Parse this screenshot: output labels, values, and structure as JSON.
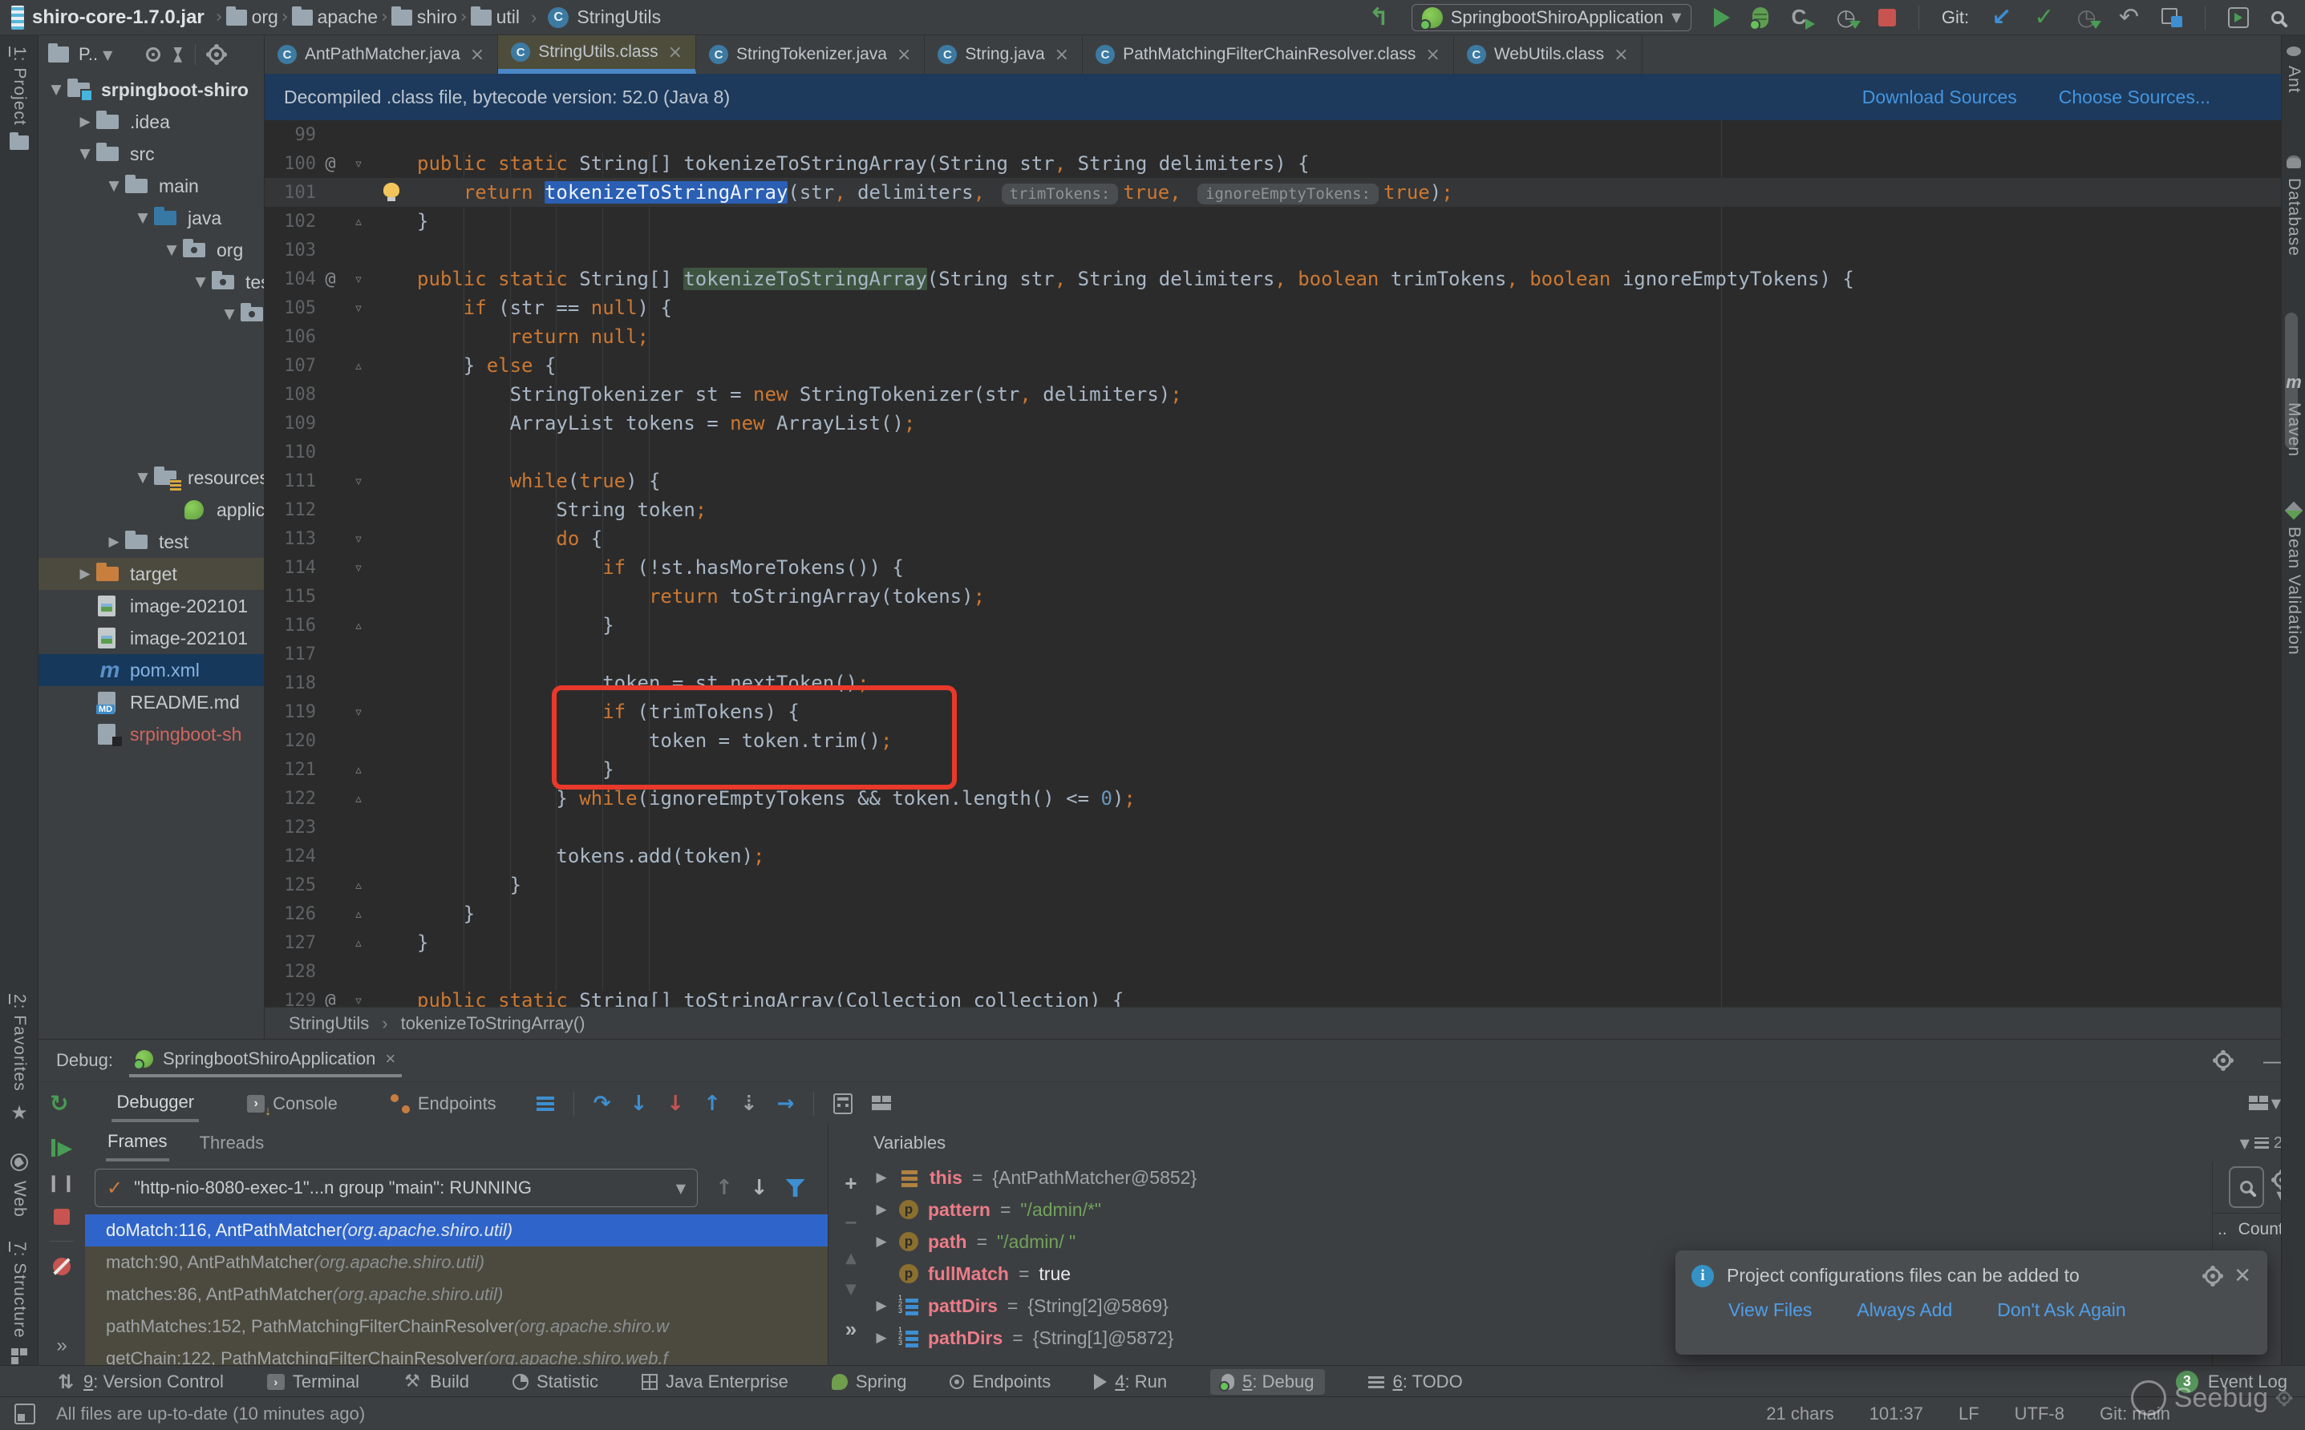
{
  "titlebar": {
    "jar": "shiro-core-1.7.0.jar",
    "path": [
      "org",
      "apache",
      "shiro",
      "util"
    ],
    "class_name": "StringUtils",
    "run_config": "SpringbootShiroApplication",
    "git_label": "Git:"
  },
  "left_stripe": {
    "top": [
      "1: Project"
    ],
    "bottom": [
      "2: Favorites",
      "Web",
      "7: Structure"
    ]
  },
  "right_stripe": [
    "Ant",
    "Database",
    "Maven",
    "Bean Validation"
  ],
  "project": {
    "header_label": "P..",
    "tree": [
      {
        "level": 0,
        "arrow": "open",
        "icon": "root",
        "label": "srpingboot-shiro",
        "cls": "t-root"
      },
      {
        "level": 1,
        "arrow": "closed",
        "icon": "folder",
        "label": ".idea"
      },
      {
        "level": 1,
        "arrow": "open",
        "icon": "folder",
        "label": "src"
      },
      {
        "level": 2,
        "arrow": "open",
        "icon": "folder",
        "label": "main"
      },
      {
        "level": 3,
        "arrow": "open",
        "icon": "java",
        "label": "java"
      },
      {
        "level": 4,
        "arrow": "open",
        "icon": "pkg",
        "label": "org"
      },
      {
        "level": 5,
        "arrow": "open",
        "icon": "pkg",
        "label": "test"
      },
      {
        "level": 6,
        "arrow": "open",
        "icon": "pkg",
        "label": ""
      },
      {
        "spacer": 164
      },
      {
        "level": 3,
        "arrow": "open",
        "icon": "res",
        "label": "resources"
      },
      {
        "level": 4,
        "arrow": "none",
        "icon": "spring",
        "label": "application"
      },
      {
        "level": 2,
        "arrow": "closed",
        "icon": "folder",
        "label": "test"
      },
      {
        "level": 1,
        "arrow": "closed",
        "icon": "target",
        "label": "target",
        "row": "r-olive"
      },
      {
        "level": 1,
        "arrow": "none",
        "icon": "img",
        "label": "image-202101"
      },
      {
        "level": 1,
        "arrow": "none",
        "icon": "img",
        "label": "image-202101"
      },
      {
        "level": 1,
        "arrow": "none",
        "icon": "maven",
        "label": "pom.xml",
        "row": "r-sel",
        "cls": "t-blue"
      },
      {
        "level": 1,
        "arrow": "none",
        "icon": "md",
        "label": "README.md"
      },
      {
        "level": 1,
        "arrow": "none",
        "icon": "file",
        "label": "srpingboot-sh",
        "cls": "t-red"
      }
    ]
  },
  "editor": {
    "tabs": [
      {
        "label": "AntPathMatcher.java"
      },
      {
        "label": "StringUtils.class",
        "active": true
      },
      {
        "label": "StringTokenizer.java"
      },
      {
        "label": "String.java"
      },
      {
        "label": "PathMatchingFilterChainResolver.class"
      },
      {
        "label": "WebUtils.class"
      }
    ],
    "banner": {
      "text": "Decompiled .class file, bytecode version: 52.0 (Java 8)",
      "download": "Download Sources",
      "choose": "Choose Sources..."
    },
    "breadcrumb": [
      "StringUtils",
      "tokenizeToStringArray()"
    ],
    "lines": [
      {
        "n": "99",
        "indent": 0,
        "tokens": []
      },
      {
        "n": "100",
        "g": "at",
        "fold": "down",
        "indent": 0,
        "tokens": [
          [
            "kw",
            "public"
          ],
          [
            "pl",
            " "
          ],
          [
            "kw",
            "static"
          ],
          [
            "pl",
            " String[] tokenizeToStringArray(String str"
          ],
          [
            "pun",
            ","
          ],
          [
            "pl",
            " String delimiters) {"
          ]
        ]
      },
      {
        "n": "101",
        "bulb": true,
        "cur": true,
        "indent": 1,
        "tokens": [
          [
            "kw",
            "return"
          ],
          [
            "pl",
            " "
          ],
          [
            "sel",
            "tokenizeToStringArray"
          ],
          [
            "pl",
            "(str"
          ],
          [
            "pun",
            ","
          ],
          [
            "pl",
            " delimiters"
          ],
          [
            "pun",
            ","
          ],
          [
            "pl",
            " "
          ],
          [
            "hint",
            "trimTokens:"
          ],
          [
            "kw",
            "true"
          ],
          [
            "pun",
            ","
          ],
          [
            "pl",
            " "
          ],
          [
            "hint",
            "ignoreEmptyTokens:"
          ],
          [
            "kw",
            "true"
          ],
          [
            "pl",
            ")"
          ],
          [
            "pun",
            ";"
          ]
        ]
      },
      {
        "n": "102",
        "fold": "up",
        "indent": 0,
        "tokens": [
          [
            "pl",
            "}"
          ]
        ]
      },
      {
        "n": "103",
        "indent": 0,
        "tokens": []
      },
      {
        "n": "104",
        "g": "at",
        "fold": "down",
        "indent": 0,
        "tokens": [
          [
            "kw",
            "public"
          ],
          [
            "pl",
            " "
          ],
          [
            "kw",
            "static"
          ],
          [
            "pl",
            " String[] "
          ],
          [
            "use",
            "tokenizeToStringArray"
          ],
          [
            "pl",
            "(String str"
          ],
          [
            "pun",
            ","
          ],
          [
            "pl",
            " String delimiters"
          ],
          [
            "pun",
            ","
          ],
          [
            "pl",
            " "
          ],
          [
            "kw",
            "boolean"
          ],
          [
            "pl",
            " trimTokens"
          ],
          [
            "pun",
            ","
          ],
          [
            "pl",
            " "
          ],
          [
            "kw",
            "boolean"
          ],
          [
            "pl",
            " ignoreEmptyTokens) {"
          ]
        ]
      },
      {
        "n": "105",
        "fold": "down",
        "indent": 1,
        "tokens": [
          [
            "kw",
            "if"
          ],
          [
            "pl",
            " (str == "
          ],
          [
            "kw",
            "null"
          ],
          [
            "pl",
            ") {"
          ]
        ]
      },
      {
        "n": "106",
        "indent": 2,
        "tokens": [
          [
            "kw",
            "return"
          ],
          [
            "pl",
            " "
          ],
          [
            "kw",
            "null"
          ],
          [
            "pun",
            ";"
          ]
        ]
      },
      {
        "n": "107",
        "fold": "up",
        "indent": 1,
        "tokens": [
          [
            "pl",
            "} "
          ],
          [
            "kw",
            "else"
          ],
          [
            "pl",
            " {"
          ]
        ]
      },
      {
        "n": "108",
        "indent": 2,
        "tokens": [
          [
            "pl",
            "StringTokenizer st = "
          ],
          [
            "kw",
            "new"
          ],
          [
            "pl",
            " StringTokenizer(str"
          ],
          [
            "pun",
            ","
          ],
          [
            "pl",
            " delimiters)"
          ],
          [
            "pun",
            ";"
          ]
        ]
      },
      {
        "n": "109",
        "indent": 2,
        "tokens": [
          [
            "pl",
            "ArrayList tokens = "
          ],
          [
            "kw",
            "new"
          ],
          [
            "pl",
            " ArrayList()"
          ],
          [
            "pun",
            ";"
          ]
        ]
      },
      {
        "n": "110",
        "indent": 0,
        "tokens": []
      },
      {
        "n": "111",
        "fold": "down",
        "indent": 2,
        "tokens": [
          [
            "kw",
            "while"
          ],
          [
            "pl",
            "("
          ],
          [
            "kw",
            "true"
          ],
          [
            "pl",
            ") {"
          ]
        ]
      },
      {
        "n": "112",
        "indent": 3,
        "tokens": [
          [
            "pl",
            "String token"
          ],
          [
            "pun",
            ";"
          ]
        ]
      },
      {
        "n": "113",
        "fold": "down",
        "indent": 3,
        "tokens": [
          [
            "kw",
            "do"
          ],
          [
            "pl",
            " {"
          ]
        ]
      },
      {
        "n": "114",
        "fold": "down",
        "indent": 4,
        "tokens": [
          [
            "kw",
            "if"
          ],
          [
            "pl",
            " (!st.hasMoreTokens()) {"
          ]
        ]
      },
      {
        "n": "115",
        "indent": 5,
        "tokens": [
          [
            "kw",
            "return"
          ],
          [
            "pl",
            " toStringArray(tokens)"
          ],
          [
            "pun",
            ";"
          ]
        ]
      },
      {
        "n": "116",
        "fold": "up",
        "indent": 4,
        "tokens": [
          [
            "pl",
            "}"
          ]
        ]
      },
      {
        "n": "117",
        "indent": 0,
        "tokens": []
      },
      {
        "n": "118",
        "indent": 4,
        "tokens": [
          [
            "pl",
            "token = st.nextToken()"
          ],
          [
            "pun",
            ";"
          ]
        ]
      },
      {
        "n": "119",
        "fold": "down",
        "indent": 4,
        "tokens": [
          [
            "kw",
            "if"
          ],
          [
            "pl",
            " (trimTokens) {"
          ]
        ]
      },
      {
        "n": "120",
        "indent": 5,
        "tokens": [
          [
            "pl",
            "token = token.trim()"
          ],
          [
            "pun",
            ";"
          ]
        ]
      },
      {
        "n": "121",
        "fold": "up",
        "indent": 4,
        "tokens": [
          [
            "pl",
            "}"
          ]
        ]
      },
      {
        "n": "122",
        "fold": "up",
        "indent": 3,
        "tokens": [
          [
            "pl",
            "} "
          ],
          [
            "kw",
            "while"
          ],
          [
            "pl",
            "(ignoreEmptyTokens && token.length() <= "
          ],
          [
            "num",
            "0"
          ],
          [
            "pl",
            ")"
          ],
          [
            "pun",
            ";"
          ]
        ]
      },
      {
        "n": "123",
        "indent": 0,
        "tokens": []
      },
      {
        "n": "124",
        "indent": 3,
        "tokens": [
          [
            "pl",
            "tokens.add(token)"
          ],
          [
            "pun",
            ";"
          ]
        ]
      },
      {
        "n": "125",
        "fold": "up",
        "indent": 2,
        "tokens": [
          [
            "pl",
            "}"
          ]
        ]
      },
      {
        "n": "126",
        "fold": "up",
        "indent": 1,
        "tokens": [
          [
            "pl",
            "}"
          ]
        ]
      },
      {
        "n": "127",
        "fold": "up",
        "indent": 0,
        "tokens": [
          [
            "pl",
            "}"
          ]
        ]
      },
      {
        "n": "128",
        "indent": 0,
        "tokens": []
      },
      {
        "n": "129",
        "g": "at",
        "fold": "down",
        "indent": 0,
        "tokens": [
          [
            "kw",
            "public"
          ],
          [
            "pl",
            " "
          ],
          [
            "kw",
            "static"
          ],
          [
            "pl",
            " String[] toStringArray(Collection collection) {"
          ]
        ]
      }
    ]
  },
  "debug": {
    "label": "Debug:",
    "session_tab": "SpringbootShiroApplication",
    "tool_tabs": [
      "Debugger",
      "Console",
      "Endpoints"
    ],
    "frames": {
      "tabs": [
        "Frames",
        "Threads"
      ],
      "thread": "\"http-nio-8080-exec-1\"...n group \"main\": RUNNING",
      "rows": [
        {
          "m": "doMatch:116, AntPathMatcher ",
          "p": "(org.apache.shiro.util)",
          "sel": true
        },
        {
          "m": "match:90, AntPathMatcher ",
          "p": "(org.apache.shiro.util)"
        },
        {
          "m": "matches:86, AntPathMatcher ",
          "p": "(org.apache.shiro.util)"
        },
        {
          "m": "pathMatches:152, PathMatchingFilterChainResolver ",
          "p": "(org.apache.shiro.w"
        },
        {
          "m": "getChain:122, PathMatchingFilterChainResolver ",
          "p": "(org.apache.shiro.web.f"
        }
      ]
    },
    "variables": {
      "title": "Variables",
      "rows": [
        {
          "icon": "this",
          "arrow": true,
          "name": "this",
          "value": "{AntPathMatcher@5852}",
          "vcls": "vv-obj"
        },
        {
          "icon": "p",
          "arrow": true,
          "name": "pattern",
          "value": "\"/admin/*\"",
          "vcls": "vv-str"
        },
        {
          "icon": "p",
          "arrow": true,
          "name": "path",
          "value": "\"/admin/ \"",
          "vcls": "vv-str"
        },
        {
          "icon": "p",
          "arrow": false,
          "name": "fullMatch",
          "value": "true",
          "vcls": "vv-bool"
        },
        {
          "icon": "arr",
          "arrow": true,
          "name": "pattDirs",
          "value": "{String[2]@5869}",
          "vcls": "vv-obj"
        },
        {
          "icon": "arr",
          "arrow": true,
          "name": "pathDirs",
          "value": "{String[1]@5872}",
          "vcls": "vv-obj"
        }
      ]
    },
    "memory": {
      "dots": "..",
      "count_label": "Count",
      "badge": "2"
    }
  },
  "notification": {
    "text": "Project configurations files can be added to",
    "links": [
      "View Files",
      "Always Add",
      "Don't Ask Again"
    ]
  },
  "bottom_bar": {
    "items": [
      {
        "icon": "vcs",
        "u": "9",
        "label": ": Version Control"
      },
      {
        "icon": "term",
        "u": "",
        "label": "Terminal"
      },
      {
        "icon": "build",
        "u": "",
        "label": "Build"
      },
      {
        "icon": "pie",
        "u": "",
        "label": "Statistic"
      },
      {
        "icon": "grid",
        "u": "",
        "label": "Java Enterprise"
      },
      {
        "icon": "leaf",
        "u": "",
        "label": "Spring"
      },
      {
        "icon": "ep",
        "u": "",
        "label": "Endpoints"
      },
      {
        "icon": "run",
        "u": "4",
        "label": ": Run"
      },
      {
        "icon": "bug",
        "u": "5",
        "label": ": Debug",
        "active": true
      },
      {
        "icon": "lines",
        "u": "6",
        "label": ": TODO"
      }
    ],
    "event_log": {
      "count": "3",
      "label": "Event Log"
    }
  },
  "statusbar": {
    "left": "All files are up-to-date (10 minutes ago)",
    "right": [
      "21 chars",
      "101:37",
      "LF",
      "UTF-8",
      "Git: main"
    ],
    "watermark": "Seebug"
  }
}
